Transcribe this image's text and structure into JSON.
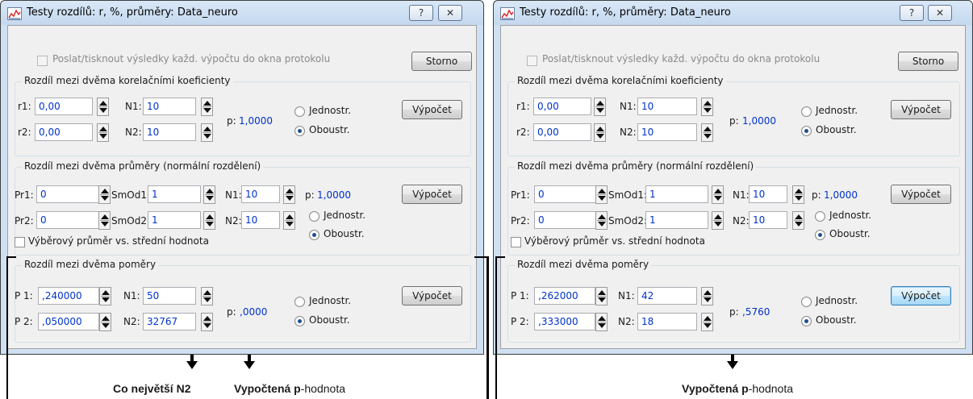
{
  "colors": {
    "title_bar": "#c4d8ee",
    "value_text": "#0033cc",
    "dialog_bg": "#f0f0f0"
  },
  "icons": {
    "app": "chart-icon",
    "help": "question-mark-icon",
    "close": "close-icon"
  },
  "left_window": {
    "title": "Testy rozdílů: r, %, průměry: Data_neuro",
    "help_glyph": "?",
    "close_glyph": "✕",
    "send_checkbox_label": "Poslat/tisknout výsledky každ. výpočtu do okna protokolu",
    "storno_label": "Storno",
    "correlation": {
      "legend": "Rozdíl mezi dvěma korelačními koeficienty",
      "r1_label": "r1:",
      "r1_value": "0,00",
      "r2_label": "r2:",
      "r2_value": "0,00",
      "n1_label": "N1:",
      "n1_value": "10",
      "n2_label": "N2:",
      "n2_value": "10",
      "p_label": "p:",
      "p_value": "1,0000",
      "one_sided": "Jednostr.",
      "two_sided": "Oboustr.",
      "selected": "two_sided",
      "compute_label": "Výpočet"
    },
    "means": {
      "legend": "Rozdíl mezi dvěma průměry (normální rozdělení)",
      "pr1_label": "Pr1:",
      "pr1_value": "0",
      "pr2_label": "Pr2:",
      "pr2_value": "0",
      "smod1_label": "SmOd1:",
      "smod1_value": "1",
      "smod2_label": "SmOd2:",
      "smod2_value": "1",
      "n1_label": "N1:",
      "n1_value": "10",
      "n2_label": "N2:",
      "n2_value": "10",
      "p_label": "p:",
      "p_value": "1,0000",
      "one_sided": "Jednostr.",
      "two_sided": "Oboustr.",
      "selected": "two_sided",
      "compute_label": "Výpočet",
      "sample_checkbox_label": "Výběrový průměr vs. střední hodnota"
    },
    "proportions": {
      "legend": "Rozdíl mezi dvěma poměry",
      "p1_label": "P 1:",
      "p1_value": ",240000",
      "p2_label": "P 2:",
      "p2_value": ",050000",
      "n1_label": "N1:",
      "n1_value": "50",
      "n2_label": "N2:",
      "n2_value": "32767",
      "p_label": "p:",
      "p_value": ",0000",
      "one_sided": "Jednostr.",
      "two_sided": "Oboustr.",
      "selected": "two_sided",
      "compute_label": "Výpočet"
    }
  },
  "right_window": {
    "title": "Testy rozdílů: r, %, průměry: Data_neuro",
    "help_glyph": "?",
    "close_glyph": "✕",
    "send_checkbox_label": "Poslat/tisknout výsledky každ. výpočtu do okna protokolu",
    "storno_label": "Storno",
    "correlation": {
      "legend": "Rozdíl mezi dvěma korelačními koeficienty",
      "r1_label": "r1:",
      "r1_value": "0,00",
      "r2_label": "r2:",
      "r2_value": "0,00",
      "n1_label": "N1:",
      "n1_value": "10",
      "n2_label": "N2:",
      "n2_value": "10",
      "p_label": "p:",
      "p_value": "1,0000",
      "one_sided": "Jednostr.",
      "two_sided": "Oboustr.",
      "selected": "two_sided",
      "compute_label": "Výpočet"
    },
    "means": {
      "legend": "Rozdíl mezi dvěma průměry (normální rozdělení)",
      "pr1_label": "Pr1:",
      "pr1_value": "0",
      "pr2_label": "Pr2:",
      "pr2_value": "0",
      "smod1_label": "SmOd1:",
      "smod1_value": "1",
      "smod2_label": "SmOd2:",
      "smod2_value": "1",
      "n1_label": "N1:",
      "n1_value": "10",
      "n2_label": "N2:",
      "n2_value": "10",
      "p_label": "p:",
      "p_value": "1,0000",
      "one_sided": "Jednostr.",
      "two_sided": "Oboustr.",
      "selected": "two_sided",
      "compute_label": "Výpočet",
      "sample_checkbox_label": "Výběrový průměr vs. střední hodnota"
    },
    "proportions": {
      "legend": "Rozdíl mezi dvěma poměry",
      "p1_label": "P 1:",
      "p1_value": ",262000",
      "p2_label": "P 2:",
      "p2_value": ",333000",
      "n1_label": "N1:",
      "n1_value": "42",
      "n2_label": "N2:",
      "n2_value": "18",
      "p_label": "p:",
      "p_value": ",5760",
      "one_sided": "Jednostr.",
      "two_sided": "Oboustr.",
      "selected": "two_sided",
      "compute_label": "Výpočet"
    }
  },
  "annotations": {
    "left_largest_n2": "Co největší N2",
    "left_p_bold": "Vypočtená p",
    "left_p_normal": "-hodnota",
    "right_p_bold": "Vypočtená p",
    "right_p_normal": "-hodnota"
  }
}
